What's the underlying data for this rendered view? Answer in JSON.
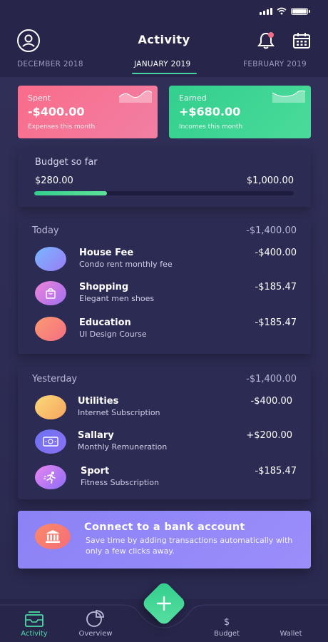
{
  "header": {
    "title": "Activity"
  },
  "months": [
    {
      "label": "DECEMBER 2018"
    },
    {
      "label": "JANUARY 2019"
    },
    {
      "label": "FEBRUARY 2019"
    }
  ],
  "summary": {
    "spent": {
      "label": "Spent",
      "amount": "-$400.00",
      "sub": "Expenses this month"
    },
    "earned": {
      "label": "Earned",
      "amount": "+$680.00",
      "sub": "Incomes this month"
    }
  },
  "budget": {
    "title": "Budget so far",
    "spent": "$280.00",
    "total": "$1,000.00",
    "progress": 0.28
  },
  "today": {
    "label": "Today",
    "total": "-$1,400.00",
    "items": [
      {
        "title": "House Fee",
        "sub": "Condo rent monthly fee",
        "amount": "-$400.00",
        "icon": "house-icon"
      },
      {
        "title": "Shopping",
        "sub": "Elegant men shoes",
        "amount": "-$185.47",
        "icon": "shopping-bag-icon"
      },
      {
        "title": "Education",
        "sub": "UI Design Course",
        "amount": "-$185.47",
        "icon": "education-icon"
      }
    ]
  },
  "yesterday": {
    "label": "Yesterday",
    "total": "-$1,400.00",
    "items": [
      {
        "title": "Utilities",
        "sub": "Internet Subscription",
        "amount": "-$400.00",
        "icon": "utilities-icon"
      },
      {
        "title": "Sallary",
        "sub": "Monthly Remuneration",
        "amount": "+$200.00",
        "icon": "money-icon"
      },
      {
        "title": "Sport",
        "sub": "Fitness Subscription",
        "amount": "-$185.47",
        "icon": "runner-icon"
      }
    ]
  },
  "bank": {
    "title": "Connect to a bank account",
    "text": "Save time by adding transactions automatically with only a few clicks away."
  },
  "nav": {
    "activity": "Activity",
    "overview": "Overview",
    "budget": "Budget",
    "budget_symbol": "$",
    "wallet": "Wallet"
  },
  "colors": {
    "background": "#27264a",
    "accent_green": "#43d6a3",
    "spent_pink": "#f5758f",
    "earned_green": "#3dd594",
    "bank_purple": "#8f86f7"
  }
}
